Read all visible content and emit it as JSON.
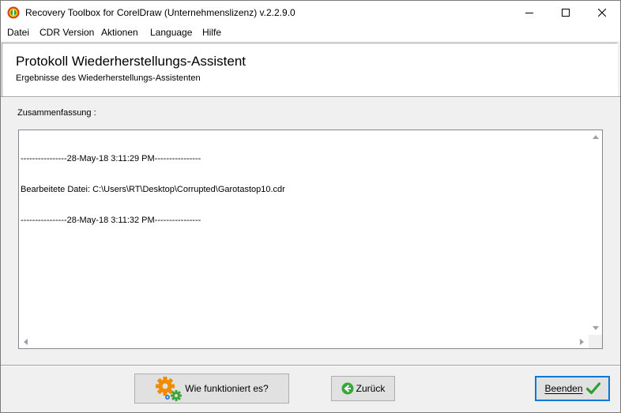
{
  "window": {
    "title": "Recovery Toolbox for CorelDraw (Unternehmenslizenz) v.2.2.9.0"
  },
  "menu": {
    "items": [
      "Datei",
      "CDR Version",
      "Aktionen",
      "Language",
      "Hilfe"
    ]
  },
  "header": {
    "title": "Protokoll Wiederherstellungs-Assistent",
    "subtitle": "Ergebnisse des Wiederherstellungs-Assistenten"
  },
  "summary": {
    "label": "Zusammenfassung :",
    "lines": [
      "----------------28-May-18 3:11:29 PM----------------",
      "Bearbeitete Datei: C:\\Users\\RT\\Desktop\\Corrupted\\Garotastop10.cdr",
      "----------------28-May-18 3:11:32 PM----------------"
    ]
  },
  "buttons": {
    "how_it_works": "Wie funktioniert es?",
    "back": "Zurück",
    "finish": "Beenden"
  },
  "icons": {
    "app": "app-logo-icon",
    "minimize": "minimize-icon",
    "maximize": "maximize-icon",
    "close": "close-icon",
    "gears": "gears-icon",
    "back": "back-arrow-icon",
    "finish": "checkmark-icon"
  },
  "colors": {
    "accent": "#0078d7",
    "check_green": "#2e9e2e",
    "gear_orange": "#f08c00",
    "gear_green": "#3aa63a"
  }
}
